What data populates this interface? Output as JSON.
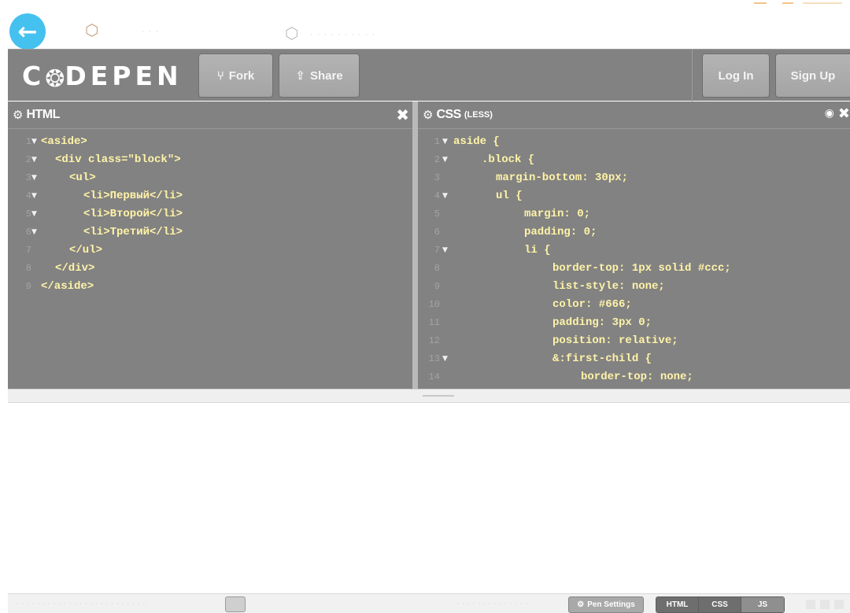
{
  "browser": {
    "back_glyph": "←",
    "icon_glyph": "⬡"
  },
  "header": {
    "logo_text_left": "C",
    "logo_mark": "❂",
    "logo_text_right": "DEPEN",
    "buttons": [
      {
        "label": "Fork",
        "icon": "fork-icon",
        "glyph": "⑂"
      },
      {
        "label": "Share",
        "icon": "share-icon",
        "glyph": "⇪"
      }
    ],
    "login_label": "Log In",
    "signup_label": "Sign Up"
  },
  "html_panel": {
    "title": "HTML",
    "gear": "⚙",
    "close": "✖",
    "lines": [
      {
        "n": "1",
        "fold": true,
        "indent": 0,
        "text": "<aside>"
      },
      {
        "n": "2",
        "fold": true,
        "indent": 1,
        "text": "<div class=\"block\">"
      },
      {
        "n": "3",
        "fold": true,
        "indent": 2,
        "text": "<ul>"
      },
      {
        "n": "4",
        "fold": true,
        "indent": 3,
        "text": "<li>Первый</li>"
      },
      {
        "n": "5",
        "fold": true,
        "indent": 3,
        "text": "<li>Второй</li>"
      },
      {
        "n": "6",
        "fold": true,
        "indent": 3,
        "text": "<li>Третий</li>"
      },
      {
        "n": "7",
        "fold": false,
        "indent": 2,
        "text": "</ul>"
      },
      {
        "n": "8",
        "fold": false,
        "indent": 1,
        "text": "</div>"
      },
      {
        "n": "9",
        "fold": false,
        "indent": 0,
        "text": "</aside>"
      }
    ]
  },
  "css_panel": {
    "title": "CSS",
    "subtitle": "(LESS)",
    "gear": "⚙",
    "eye": "◉",
    "close": "✖",
    "lines": [
      {
        "n": "1",
        "fold": true,
        "indent": 0,
        "text": "aside {"
      },
      {
        "n": "2",
        "fold": true,
        "indent": 2,
        "text": ".block {"
      },
      {
        "n": "3",
        "fold": false,
        "indent": 3,
        "text": "margin-bottom: 30px;"
      },
      {
        "n": "4",
        "fold": true,
        "indent": 3,
        "text": "ul {"
      },
      {
        "n": "5",
        "fold": false,
        "indent": 5,
        "text": "margin: 0;"
      },
      {
        "n": "6",
        "fold": false,
        "indent": 5,
        "text": "padding: 0;"
      },
      {
        "n": "7",
        "fold": true,
        "indent": 5,
        "text": "li {"
      },
      {
        "n": "8",
        "fold": false,
        "indent": 7,
        "text": "border-top: 1px solid #ccc;"
      },
      {
        "n": "9",
        "fold": false,
        "indent": 7,
        "text": "list-style: none;"
      },
      {
        "n": "10",
        "fold": false,
        "indent": 7,
        "text": "color: #666;"
      },
      {
        "n": "11",
        "fold": false,
        "indent": 7,
        "text": "padding: 3px 0;"
      },
      {
        "n": "12",
        "fold": false,
        "indent": 7,
        "text": "position: relative;"
      },
      {
        "n": "13",
        "fold": true,
        "indent": 7,
        "text": "&:first-child {"
      },
      {
        "n": "14",
        "fold": false,
        "indent": 9,
        "text": "border-top: none;"
      }
    ]
  },
  "footer": {
    "pen_settings_label": "Pen Settings",
    "pen_settings_icon": "gear-icon",
    "pen_settings_glyph": "⚙",
    "tabs": [
      "HTML",
      "CSS",
      "JS"
    ]
  }
}
